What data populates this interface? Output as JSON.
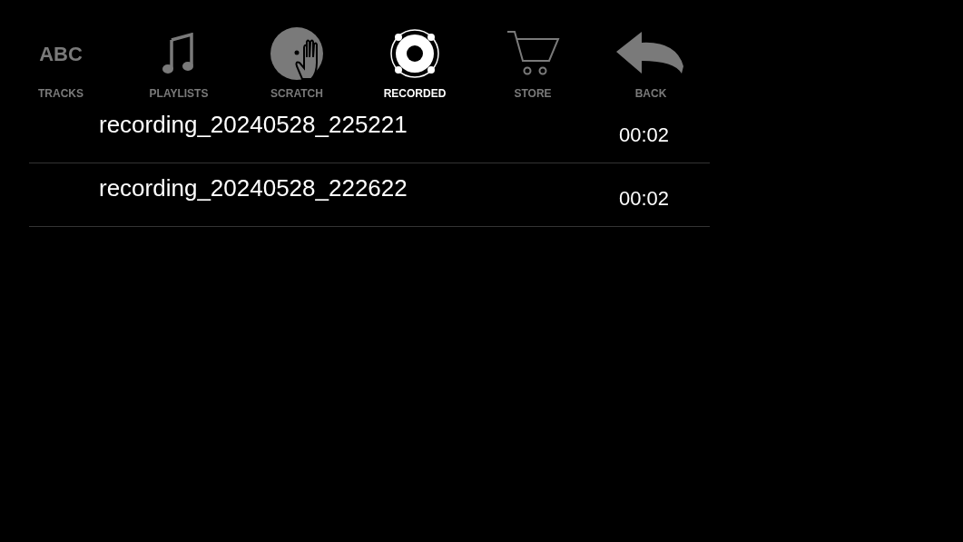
{
  "tabs": [
    {
      "kind": "abc",
      "icon_text": "ABC",
      "label": "TRACKS",
      "selected": false
    },
    {
      "kind": "note",
      "label": "PLAYLISTS",
      "selected": false
    },
    {
      "kind": "scratch",
      "label": "SCRATCH",
      "selected": false
    },
    {
      "kind": "recorded",
      "label": "RECORDED",
      "selected": true
    },
    {
      "kind": "cart",
      "label": "STORE",
      "selected": false
    },
    {
      "kind": "back",
      "label": "BACK",
      "selected": false
    }
  ],
  "recordings": [
    {
      "name": "recording_20240528_225221",
      "duration": "00:02"
    },
    {
      "name": "recording_20240528_222622",
      "duration": "00:02"
    }
  ]
}
